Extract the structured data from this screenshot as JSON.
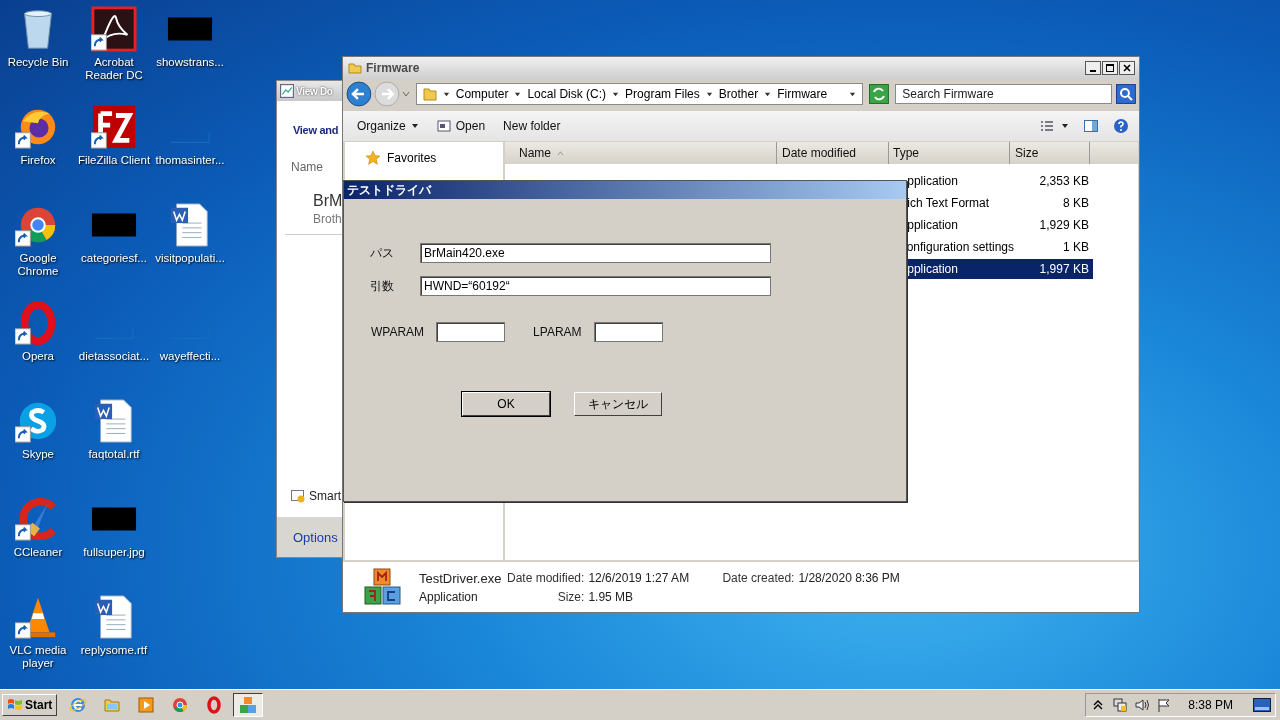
{
  "desktop_icons": [
    {
      "label": "Recycle Bin",
      "kind": "recycle",
      "shortcut": false
    },
    {
      "label": "Firefox",
      "kind": "firefox",
      "shortcut": true
    },
    {
      "label": "Google Chrome",
      "kind": "chrome",
      "shortcut": true
    },
    {
      "label": "Opera",
      "kind": "opera",
      "shortcut": true
    },
    {
      "label": "Skype",
      "kind": "skype",
      "shortcut": true
    },
    {
      "label": "CCleaner",
      "kind": "ccleaner",
      "shortcut": true
    },
    {
      "label": "VLC media player",
      "kind": "vlc",
      "shortcut": true
    },
    {
      "label": "Acrobat Reader DC",
      "kind": "acrobat",
      "shortcut": true
    },
    {
      "label": "FileZilla Client",
      "kind": "filezilla",
      "shortcut": true
    },
    {
      "label": "categoriesf...",
      "kind": "redacted",
      "shortcut": false
    },
    {
      "label": "dietassociat...",
      "kind": "blank",
      "shortcut": false
    },
    {
      "label": "faqtotal.rtf",
      "kind": "word",
      "shortcut": false
    },
    {
      "label": "fullsuper.jpg",
      "kind": "redacted",
      "shortcut": false
    },
    {
      "label": "replysome.rtf",
      "kind": "word",
      "shortcut": false
    },
    {
      "label": "showstrans...",
      "kind": "redacted",
      "shortcut": false
    },
    {
      "label": "thomasinter...",
      "kind": "blank",
      "shortcut": false
    },
    {
      "label": "visitpopulati...",
      "kind": "word",
      "shortcut": false
    },
    {
      "label": "wayeffecti...",
      "kind": "blank",
      "shortcut": false
    }
  ],
  "back_window": {
    "title": "View Do",
    "heading": "View and",
    "column": "Name",
    "item_title": "BrM",
    "item_subtitle": "Broth",
    "task": "Smart",
    "footer_link": "Options"
  },
  "explorer": {
    "title": "Firmware",
    "breadcrumb": [
      "Computer",
      "Local Disk (C:)",
      "Program Files",
      "Brother",
      "Firmware"
    ],
    "search": {
      "placeholder": "Search Firmware"
    },
    "toolbar": [
      {
        "label": "Organize",
        "kind": "menu"
      },
      {
        "label": "Open",
        "kind": "icon"
      },
      {
        "label": "New folder",
        "kind": "plain"
      }
    ],
    "nav": [
      {
        "label": "Favorites"
      }
    ],
    "columns": [
      "Name",
      "Date modified",
      "Type",
      "Size"
    ],
    "rows": [
      {
        "type": "pplication",
        "size": "2,353 KB",
        "selected": false
      },
      {
        "type": "ich Text Format",
        "size": "8 KB",
        "selected": false
      },
      {
        "type": "pplication",
        "size": "1,929 KB",
        "selected": false
      },
      {
        "type": "onfiguration settings",
        "size": "1 KB",
        "selected": false
      },
      {
        "type": "pplication",
        "size": "1,997 KB",
        "selected": true
      }
    ],
    "details": {
      "name": "TestDriver.exe",
      "type": "Application",
      "date_modified_label": "Date modified:",
      "date_modified": "12/6/2019 1:27 AM",
      "date_created_label": "Date created:",
      "date_created": "1/28/2020 8:36 PM",
      "size_label": "Size:",
      "size": "1.95 MB"
    }
  },
  "dialog": {
    "title": "テストドライバ",
    "fields": [
      {
        "label": "パス",
        "value": "BrMain420.exe"
      },
      {
        "label": "引数",
        "value": "HWND=“60192“"
      }
    ],
    "params": [
      {
        "label": "WPARAM"
      },
      {
        "label": "LPARAM"
      }
    ],
    "buttons": [
      {
        "label": "OK",
        "default": true
      },
      {
        "label": "キャンセル",
        "default": false
      }
    ]
  },
  "taskbar": {
    "start": "Start",
    "apps": [
      {
        "kind": "ie",
        "selected": false
      },
      {
        "kind": "folder",
        "selected": false
      },
      {
        "kind": "media",
        "selected": false
      },
      {
        "kind": "chrome",
        "selected": false
      },
      {
        "kind": "opera",
        "selected": false
      },
      {
        "kind": "blocks",
        "selected": true
      }
    ],
    "clock": "8:38 PM"
  }
}
